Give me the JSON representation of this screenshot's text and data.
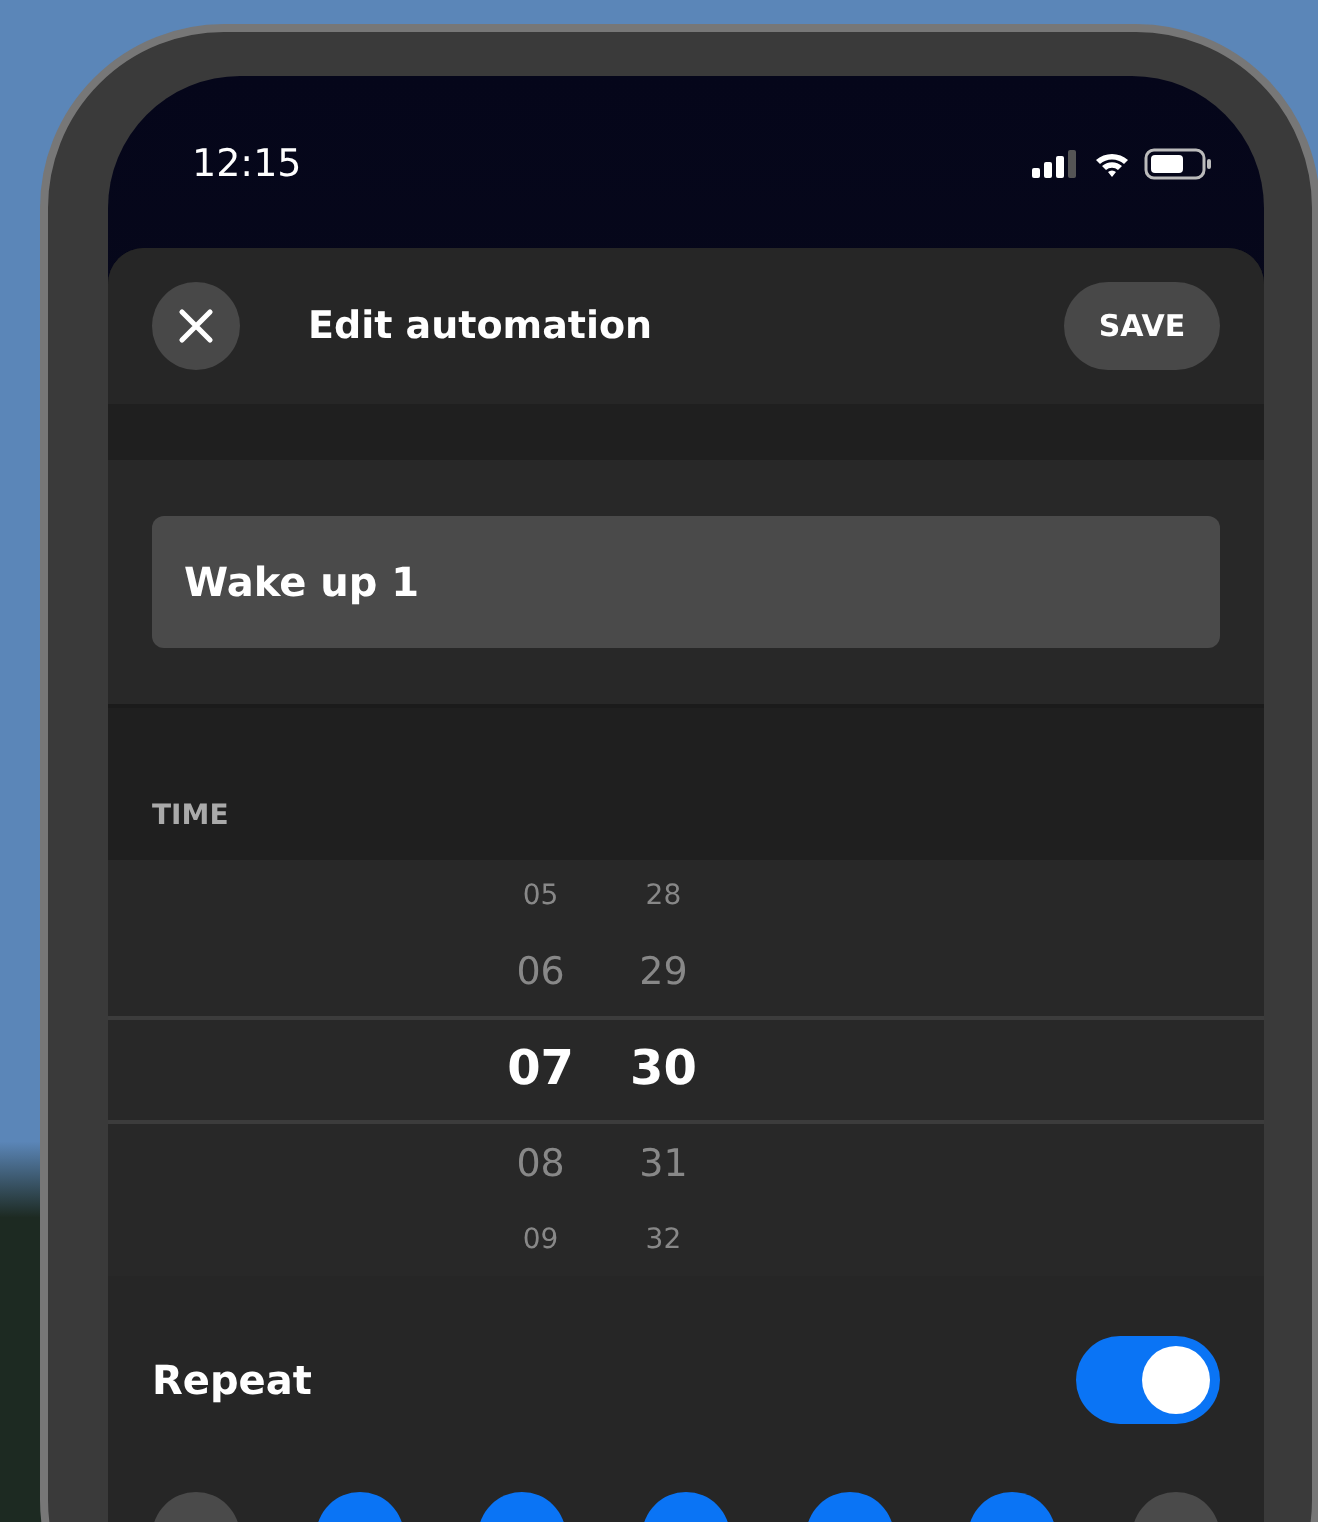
{
  "status_bar": {
    "time": "12:15"
  },
  "header": {
    "title": "Edit automation",
    "save": "SAVE"
  },
  "name_field": {
    "value": "Wake up 1"
  },
  "time": {
    "label": "TIME",
    "hours": [
      {
        "text": "05",
        "selected": false
      },
      {
        "text": "06",
        "selected": false
      },
      {
        "text": "07",
        "selected": true
      },
      {
        "text": "08",
        "selected": false
      },
      {
        "text": "09",
        "selected": false
      }
    ],
    "minutes": [
      {
        "text": "28",
        "selected": false
      },
      {
        "text": "29",
        "selected": false
      },
      {
        "text": "30",
        "selected": true
      },
      {
        "text": "31",
        "selected": false
      },
      {
        "text": "32",
        "selected": false
      }
    ]
  },
  "repeat": {
    "label": "Repeat",
    "on": true
  },
  "days": [
    {
      "selected": false
    },
    {
      "selected": true
    },
    {
      "selected": true
    },
    {
      "selected": true
    },
    {
      "selected": true
    },
    {
      "selected": true
    },
    {
      "selected": false
    }
  ]
}
